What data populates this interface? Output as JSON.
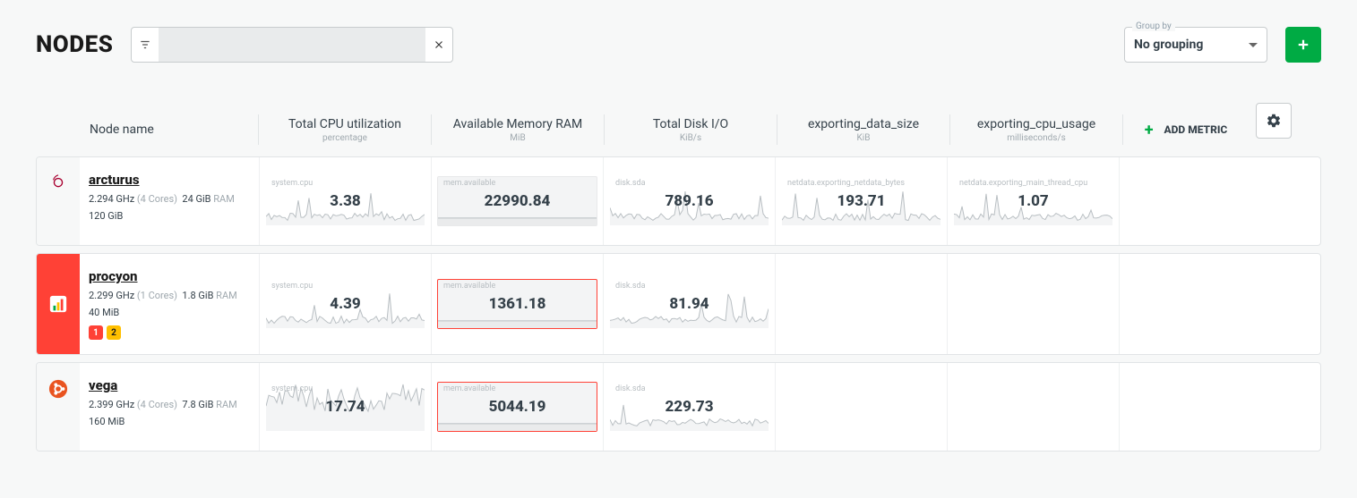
{
  "page_title": "NODES",
  "filter": {
    "placeholder": "",
    "value": ""
  },
  "grouping": {
    "label": "Group by",
    "value": "No grouping"
  },
  "add_metric_label": "ADD METRIC",
  "columns": [
    {
      "title": "Node name",
      "sub": ""
    },
    {
      "title": "Total CPU utilization",
      "sub": "percentage"
    },
    {
      "title": "Available Memory RAM",
      "sub": "MiB"
    },
    {
      "title": "Total Disk I/O",
      "sub": "KiB/s"
    },
    {
      "title": "exporting_data_size",
      "sub": "KiB"
    },
    {
      "title": "exporting_cpu_usage",
      "sub": "milliseconds/s"
    }
  ],
  "nodes": [
    {
      "os": "debian",
      "name": "arcturus",
      "ghz": "2.294 GHz",
      "cores": "(4 Cores)",
      "ram": "24 GiB",
      "ram_label": "RAM",
      "disk": "120 GiB",
      "alerts": {
        "critical": 0,
        "warning": 0
      },
      "metrics": [
        {
          "chart": "system.cpu",
          "value": "3.38",
          "alert": false,
          "highlight": false,
          "seed": 1
        },
        {
          "chart": "mem.available",
          "value": "22990.84",
          "alert": false,
          "highlight": true,
          "seed": 2,
          "flat": true
        },
        {
          "chart": "disk.sda",
          "value": "789.16",
          "alert": false,
          "highlight": false,
          "seed": 3
        },
        {
          "chart": "netdata.exporting_netdata_bytes",
          "value": "193.71",
          "alert": false,
          "highlight": false,
          "seed": 4
        },
        {
          "chart": "netdata.exporting_main_thread_cpu",
          "value": "1.07",
          "alert": false,
          "highlight": false,
          "seed": 5
        }
      ]
    },
    {
      "os": "netdata",
      "os_alert": true,
      "name": "procyon",
      "ghz": "2.299 GHz",
      "cores": "(1 Cores)",
      "ram": "1.8 GiB",
      "ram_label": "RAM",
      "disk": "40 MiB",
      "alerts": {
        "critical": 1,
        "warning": 2
      },
      "metrics": [
        {
          "chart": "system.cpu",
          "value": "4.39",
          "alert": false,
          "highlight": false,
          "seed": 6
        },
        {
          "chart": "mem.available",
          "value": "1361.18",
          "alert": true,
          "highlight": true,
          "seed": 7,
          "flat": true
        },
        {
          "chart": "disk.sda",
          "value": "81.94",
          "alert": false,
          "highlight": false,
          "seed": 8
        },
        {
          "chart": "",
          "value": "",
          "alert": false,
          "highlight": false,
          "empty": true
        },
        {
          "chart": "",
          "value": "",
          "alert": false,
          "highlight": false,
          "empty": true
        }
      ]
    },
    {
      "os": "ubuntu",
      "name": "vega",
      "ghz": "2.399 GHz",
      "cores": "(4 Cores)",
      "ram": "7.8 GiB",
      "ram_label": "RAM",
      "disk": "160 MiB",
      "alerts": {
        "critical": 0,
        "warning": 0
      },
      "metrics": [
        {
          "chart": "system.cpu",
          "value": "17.74",
          "alert": false,
          "highlight": false,
          "seed": 9,
          "busy": true
        },
        {
          "chart": "mem.available",
          "value": "5044.19",
          "alert": true,
          "highlight": true,
          "seed": 10,
          "flat": true
        },
        {
          "chart": "disk.sda",
          "value": "229.73",
          "alert": false,
          "highlight": false,
          "seed": 11
        },
        {
          "chart": "",
          "value": "",
          "alert": false,
          "highlight": false,
          "empty": true
        },
        {
          "chart": "",
          "value": "",
          "alert": false,
          "highlight": false,
          "empty": true
        }
      ]
    }
  ]
}
